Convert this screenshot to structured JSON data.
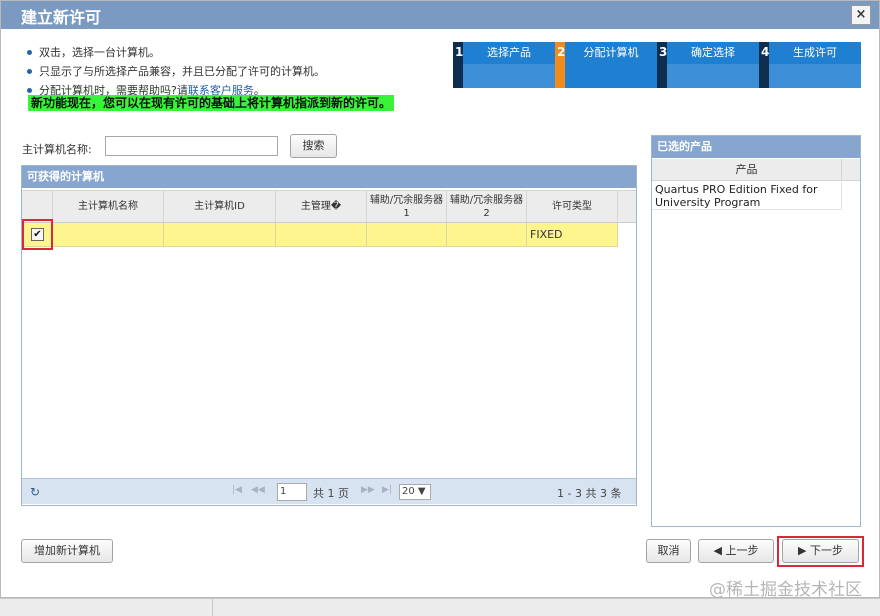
{
  "dialog": {
    "title": "建立新许可",
    "close": "×"
  },
  "notes": {
    "items": [
      "双击，选择一台计算机。",
      "只显示了与所选择产品兼容，并且已分配了许可的计算机。"
    ],
    "help_prefix": "分配计算机时，需要帮助吗?请",
    "help_link": "联系客户服务",
    "help_suffix": "。",
    "highlight": "新功能现在，您可以在现有许可的基础上将计算机指派到新的许可。"
  },
  "steps": [
    {
      "number": "1",
      "label": "选择产品"
    },
    {
      "number": "2",
      "label": "分配计算机"
    },
    {
      "number": "3",
      "label": "确定选择"
    },
    {
      "number": "4",
      "label": "生成许可"
    }
  ],
  "search": {
    "label": "主计算机名称:",
    "value": "",
    "button": "搜索"
  },
  "available_panel": {
    "title": "可获得的计算机",
    "columns": [
      "主计算机名称",
      "主计算机ID",
      "主管理�",
      "辅助/冗余服务器1",
      "辅助/冗余服务器2",
      "许可类型"
    ],
    "rows": [
      {
        "checked": "✔",
        "host_name": "",
        "host_id": "",
        "main_admin": "",
        "backup1": "",
        "backup2": "",
        "license_type": "FIXED"
      }
    ],
    "pager": {
      "refresh": "↻",
      "first": "|◀",
      "prev": "◀◀",
      "page_value": "1",
      "page_suffix": "共 1 页",
      "next": "▶▶",
      "last": "▶|",
      "rows_per_page": "20 ▼",
      "summary": "1 - 3  共 3 条"
    }
  },
  "selected_products": {
    "title": "已选的产品",
    "column": "产品",
    "items": [
      "Quartus PRO Edition Fixed for University Program"
    ]
  },
  "buttons": {
    "add_computer": "增加新计算机",
    "cancel": "取消",
    "prev_step": "◀  上一步",
    "next_step": "▶  下一步"
  },
  "watermark": "@稀土掘金技术社区",
  "colors": {
    "title_bar": "#7a9ac2",
    "step_active": "#f28a1c",
    "row_highlight": "#fff58f",
    "red_outline": "#d9283a"
  }
}
